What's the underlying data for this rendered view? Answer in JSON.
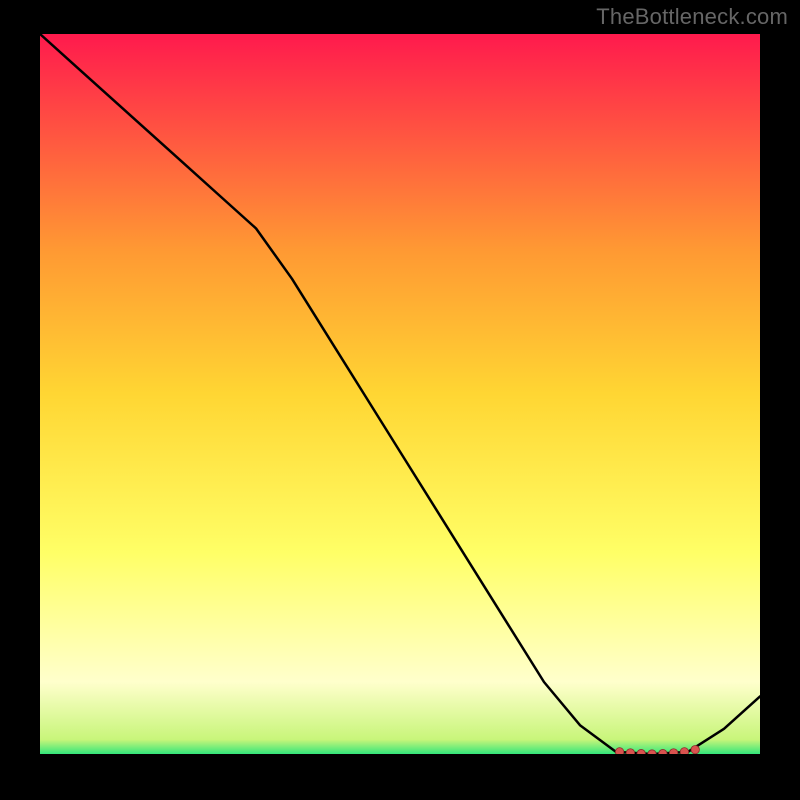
{
  "watermark": "TheBottleneck.com",
  "chart_data": {
    "type": "line",
    "x": [
      0,
      5,
      10,
      15,
      20,
      25,
      30,
      35,
      40,
      45,
      50,
      55,
      60,
      65,
      70,
      75,
      80,
      85,
      90,
      95,
      100
    ],
    "values": [
      100,
      95.5,
      91,
      86.5,
      82,
      77.5,
      73,
      66,
      58,
      50,
      42,
      34,
      26,
      18,
      10,
      4,
      0.3,
      0,
      0.3,
      3.5,
      8
    ],
    "title": "",
    "xlabel": "",
    "ylabel": "",
    "xlim": [
      0,
      100
    ],
    "ylim": [
      0,
      100
    ],
    "annotations": {
      "trough_markers_x": [
        80.5,
        82,
        83.5,
        85,
        86.5,
        88,
        89.5,
        91
      ],
      "trough_markers_y": [
        0.3,
        0.15,
        0.05,
        0,
        0.05,
        0.15,
        0.3,
        0.6
      ]
    },
    "background_gradient": {
      "top": "#ff1a4d",
      "mid_upper": "#ff9933",
      "mid": "#ffd633",
      "mid_lower": "#ffff66",
      "lower": "#ffffcc",
      "bottom": "#33e67a"
    },
    "line_color": "#000000",
    "marker_color": "#d9534f"
  }
}
